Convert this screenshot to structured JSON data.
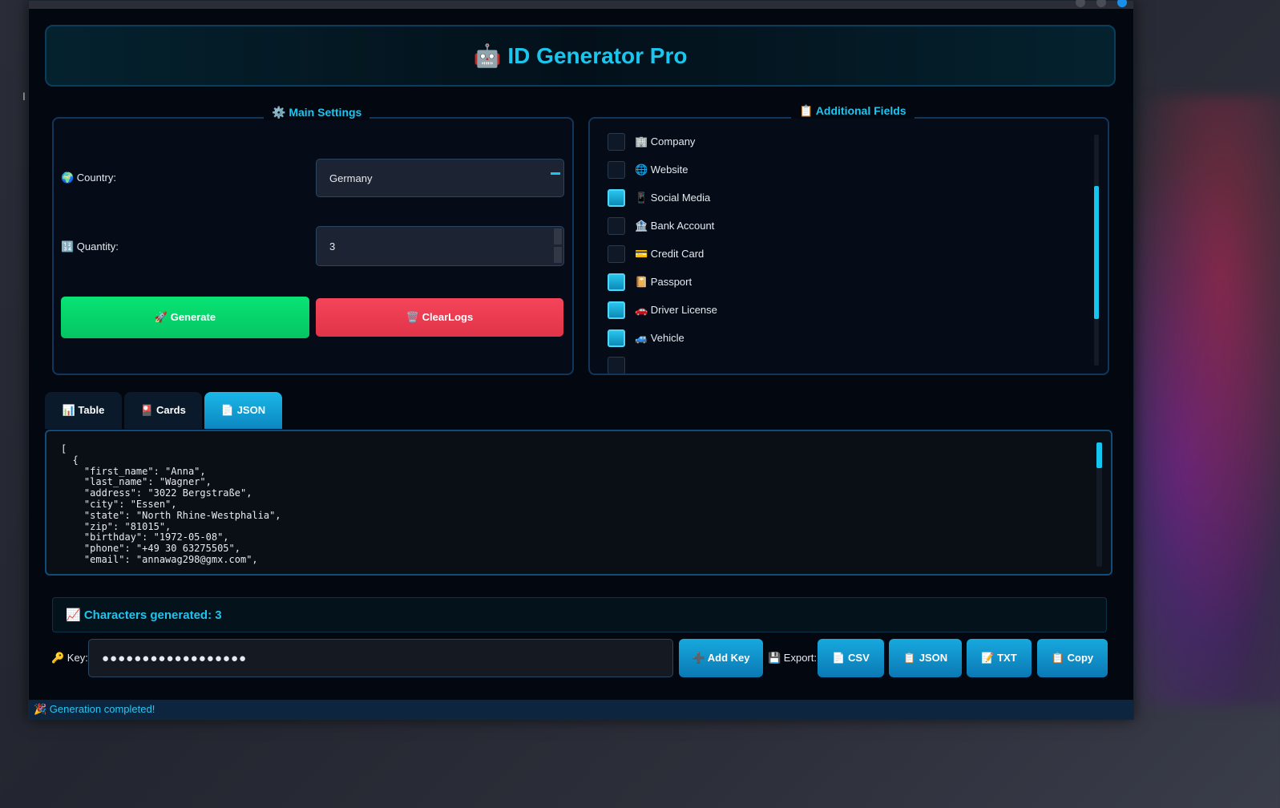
{
  "app": {
    "title": "ID Generator Pro",
    "title_emoji": "🤖"
  },
  "main_settings": {
    "title": "⚙️ Main Settings",
    "country_label": "🌍 Country:",
    "country_value": "Germany",
    "quantity_label": "🔢 Quantity:",
    "quantity_value": "3",
    "generate_label": "🚀 Generate",
    "clear_label": "🗑️ ClearLogs"
  },
  "additional_fields": {
    "title": "📋 Additional Fields",
    "items": [
      {
        "label": "🏢 Company",
        "checked": false
      },
      {
        "label": "🌐 Website",
        "checked": false
      },
      {
        "label": "📱 Social Media",
        "checked": true
      },
      {
        "label": "🏦 Bank Account",
        "checked": false
      },
      {
        "label": "💳 Credit Card",
        "checked": false
      },
      {
        "label": "📔 Passport",
        "checked": true
      },
      {
        "label": "🚗 Driver License",
        "checked": true
      },
      {
        "label": "🚙 Vehicle",
        "checked": true
      }
    ]
  },
  "tabs": [
    {
      "label": "📊 Table",
      "active": false
    },
    {
      "label": "🎴 Cards",
      "active": false
    },
    {
      "label": "📄 JSON",
      "active": true
    }
  ],
  "json_output": "[\n  {\n    \"first_name\": \"Anna\",\n    \"last_name\": \"Wagner\",\n    \"address\": \"3022 Bergstraße\",\n    \"city\": \"Essen\",\n    \"state\": \"North Rhine-Westphalia\",\n    \"zip\": \"81015\",\n    \"birthday\": \"1972-05-08\",\n    \"phone\": \"+49 30 63275505\",\n    \"email\": \"annawag298@gmx.com\",",
  "stats": {
    "text": "📈 Characters generated: 3"
  },
  "key_bar": {
    "key_label": "🔑 Key:",
    "key_value": "●●●●●●●●●●●●●●●●●●",
    "add_key_label": "➕ Add Key",
    "export_label": "💾 Export:",
    "csv_label": "📄 CSV",
    "json_label": "📋 JSON",
    "txt_label": "📝 TXT",
    "copy_label": "📋 Copy"
  },
  "status": {
    "text": "🎉 Generation completed!"
  },
  "colors": {
    "accent": "#1cc6f0",
    "generate": "#05c563",
    "clear": "#e03449",
    "window_bg": "#03070f"
  }
}
